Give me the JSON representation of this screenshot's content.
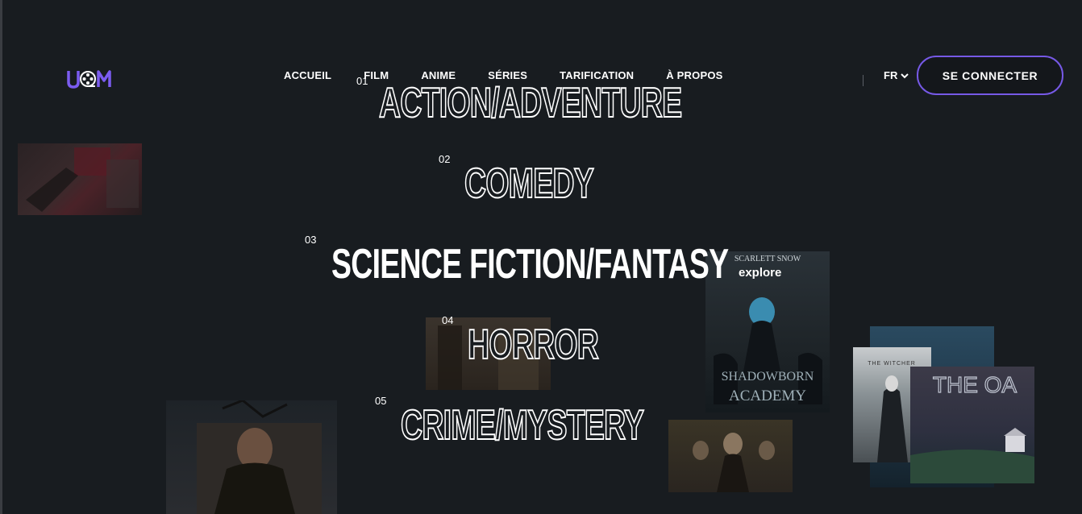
{
  "header": {
    "nav": [
      "ACCUEIL",
      "FILM",
      "ANIME",
      "SÉRIES",
      "TARIFICATION",
      "À PROPOS"
    ],
    "language": "FR",
    "login_label": "SE CONNECTER"
  },
  "genres": [
    {
      "num": "01",
      "title": "ACTION/ADVENTURE"
    },
    {
      "num": "02",
      "title": "COMEDY"
    },
    {
      "num": "03",
      "title": "SCIENCE FICTION/FANTASY"
    },
    {
      "num": "04",
      "title": "HORROR"
    },
    {
      "num": "05",
      "title": "CRIME/MYSTERY"
    }
  ],
  "explore_label": "explore",
  "posters": {
    "shadowborn_author": "SCARLETT SNOW",
    "shadowborn_title_1": "SHADOWBORN",
    "shadowborn_title_2": "ACADEMY",
    "witcher_title": "THE WITCHER",
    "oa_title": "THE OA"
  },
  "colors": {
    "background": "#181c20",
    "accent": "#7659e6",
    "logo": "#7b5cf0"
  }
}
